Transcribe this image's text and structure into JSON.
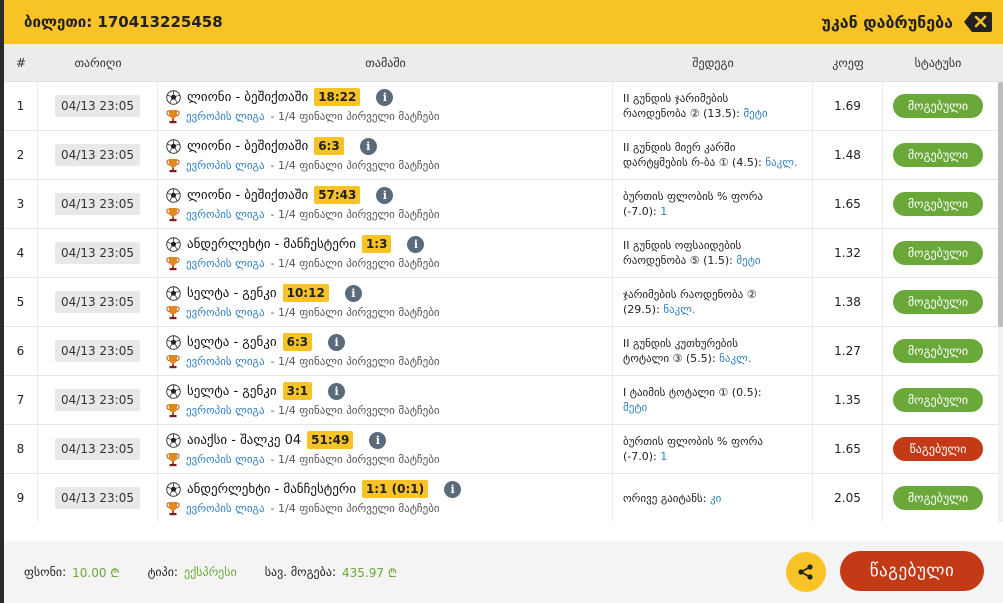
{
  "header": {
    "ticket_label": "ბილეთი: 170413225458",
    "back_label": "უკან დაბრუნება"
  },
  "columns": {
    "num": "#",
    "date": "თარიღი",
    "game": "თამაში",
    "result": "შედეგი",
    "coef": "კოეფ",
    "status": "სტატუსი"
  },
  "rows": [
    {
      "num": "1",
      "date": "04/13 23:05",
      "teams": "ლიონი - ბეშიქთაში",
      "score": "18:22",
      "league": "ევროპის ლიგა",
      "stage": "- 1/4 ფინალი პირველი მატჩები",
      "result_line1": "II გუნდის ჯარიმების",
      "result_line2": "რაოდენობა ② (13.5):",
      "selection": "მეტი",
      "coef": "1.69",
      "status": "მოგებული",
      "status_type": "won"
    },
    {
      "num": "2",
      "date": "04/13 23:05",
      "teams": "ლიონი - ბეშიქთაში",
      "score": "6:3",
      "league": "ევროპის ლიგა",
      "stage": "- 1/4 ფინალი პირველი მატჩები",
      "result_line1": "II გუნდის მიერ კარში",
      "result_line2": "დარტყმების რ-ბა ① (4.5):",
      "selection": "ნაკლ.",
      "coef": "1.48",
      "status": "მოგებული",
      "status_type": "won"
    },
    {
      "num": "3",
      "date": "04/13 23:05",
      "teams": "ლიონი - ბეშიქთაში",
      "score": "57:43",
      "league": "ევროპის ლიგა",
      "stage": "- 1/4 ფინალი პირველი მატჩები",
      "result_line1": "ბურთის ფლობის % ფორა",
      "result_line2": "(-7.0):",
      "selection": "1",
      "coef": "1.65",
      "status": "მოგებული",
      "status_type": "won"
    },
    {
      "num": "4",
      "date": "04/13 23:05",
      "teams": "ანდერლეხტი - მანჩესტერი",
      "score": "1:3",
      "league": "ევროპის ლიგა",
      "stage": "- 1/4 ფინალი პირველი მატჩები",
      "result_line1": "II გუნდის ოფსაიდების",
      "result_line2": "რაოდენობა ⑤ (1.5):",
      "selection": "მეტი",
      "coef": "1.32",
      "status": "მოგებული",
      "status_type": "won"
    },
    {
      "num": "5",
      "date": "04/13 23:05",
      "teams": "სელტა - გენკი",
      "score": "10:12",
      "league": "ევროპის ლიგა",
      "stage": "- 1/4 ფინალი პირველი მატჩები",
      "result_line1": "ჯარიმების რაოდენობა ②",
      "result_line2": "(29.5):",
      "selection": "ნაკლ.",
      "coef": "1.38",
      "status": "მოგებული",
      "status_type": "won"
    },
    {
      "num": "6",
      "date": "04/13 23:05",
      "teams": "სელტა - გენკი",
      "score": "6:3",
      "league": "ევროპის ლიგა",
      "stage": "- 1/4 ფინალი პირველი მატჩები",
      "result_line1": "II გუნდის კუთხურების",
      "result_line2": "ტოტალი ③ (5.5):",
      "selection": "ნაკლ.",
      "coef": "1.27",
      "status": "მოგებული",
      "status_type": "won"
    },
    {
      "num": "7",
      "date": "04/13 23:05",
      "teams": "სელტა - გენკი",
      "score": "3:1",
      "league": "ევროპის ლიგა",
      "stage": "- 1/4 ფინალი პირველი მატჩები",
      "result_line1": "I ტაიმის ტოტალი ① (0.5):",
      "result_line2": "",
      "selection": "მეტი",
      "coef": "1.35",
      "status": "მოგებული",
      "status_type": "won"
    },
    {
      "num": "8",
      "date": "04/13 23:05",
      "teams": "აიაქსი - შალკე 04",
      "score": "51:49",
      "league": "ევროპის ლიგა",
      "stage": "- 1/4 ფინალი პირველი მატჩები",
      "result_line1": "ბურთის ფლობის % ფორა",
      "result_line2": "(-7.0):",
      "selection": "1",
      "coef": "1.65",
      "status": "წაგებული",
      "status_type": "lost"
    },
    {
      "num": "9",
      "date": "04/13 23:05",
      "teams": "ანდერლეხტი - მანჩესტერი",
      "score": "1:1 (0:1)",
      "league": "ევროპის ლიგა",
      "stage": "- 1/4 ფინალი პირველი მატჩები",
      "result_line1": "ორივე გაიტანს:",
      "result_line2": "",
      "selection": "კი",
      "coef": "2.05",
      "status": "მოგებული",
      "status_type": "won"
    }
  ],
  "footer": {
    "stake_label": "ფსონი:",
    "stake_value": "10.00 ₾",
    "type_label": "ტიპი:",
    "type_value": "ექსპრესი",
    "total_label": "სავ. მოგება:",
    "total_value": "435.97 ₾",
    "final_status": "წაგებული"
  },
  "icons": {
    "close": "close-x-icon",
    "ball": "soccer-ball-icon",
    "cup": "europa-league-cup-icon",
    "info": "info-icon",
    "share": "share-icon"
  },
  "colors": {
    "header": "#f7c327",
    "won": "#6aa83a",
    "lost": "#c23a16",
    "link": "#2e7fc3"
  }
}
